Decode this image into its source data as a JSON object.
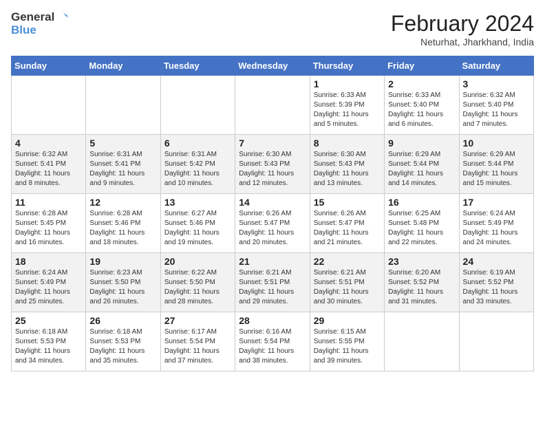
{
  "logo": {
    "text_general": "General",
    "text_blue": "Blue"
  },
  "title": "February 2024",
  "subtitle": "Neturhat, Jharkhand, India",
  "days_of_week": [
    "Sunday",
    "Monday",
    "Tuesday",
    "Wednesday",
    "Thursday",
    "Friday",
    "Saturday"
  ],
  "weeks": [
    [
      {
        "day": "",
        "info": ""
      },
      {
        "day": "",
        "info": ""
      },
      {
        "day": "",
        "info": ""
      },
      {
        "day": "",
        "info": ""
      },
      {
        "day": "1",
        "info": "Sunrise: 6:33 AM\nSunset: 5:39 PM\nDaylight: 11 hours and 5 minutes."
      },
      {
        "day": "2",
        "info": "Sunrise: 6:33 AM\nSunset: 5:40 PM\nDaylight: 11 hours and 6 minutes."
      },
      {
        "day": "3",
        "info": "Sunrise: 6:32 AM\nSunset: 5:40 PM\nDaylight: 11 hours and 7 minutes."
      }
    ],
    [
      {
        "day": "4",
        "info": "Sunrise: 6:32 AM\nSunset: 5:41 PM\nDaylight: 11 hours and 8 minutes."
      },
      {
        "day": "5",
        "info": "Sunrise: 6:31 AM\nSunset: 5:41 PM\nDaylight: 11 hours and 9 minutes."
      },
      {
        "day": "6",
        "info": "Sunrise: 6:31 AM\nSunset: 5:42 PM\nDaylight: 11 hours and 10 minutes."
      },
      {
        "day": "7",
        "info": "Sunrise: 6:30 AM\nSunset: 5:43 PM\nDaylight: 11 hours and 12 minutes."
      },
      {
        "day": "8",
        "info": "Sunrise: 6:30 AM\nSunset: 5:43 PM\nDaylight: 11 hours and 13 minutes."
      },
      {
        "day": "9",
        "info": "Sunrise: 6:29 AM\nSunset: 5:44 PM\nDaylight: 11 hours and 14 minutes."
      },
      {
        "day": "10",
        "info": "Sunrise: 6:29 AM\nSunset: 5:44 PM\nDaylight: 11 hours and 15 minutes."
      }
    ],
    [
      {
        "day": "11",
        "info": "Sunrise: 6:28 AM\nSunset: 5:45 PM\nDaylight: 11 hours and 16 minutes."
      },
      {
        "day": "12",
        "info": "Sunrise: 6:28 AM\nSunset: 5:46 PM\nDaylight: 11 hours and 18 minutes."
      },
      {
        "day": "13",
        "info": "Sunrise: 6:27 AM\nSunset: 5:46 PM\nDaylight: 11 hours and 19 minutes."
      },
      {
        "day": "14",
        "info": "Sunrise: 6:26 AM\nSunset: 5:47 PM\nDaylight: 11 hours and 20 minutes."
      },
      {
        "day": "15",
        "info": "Sunrise: 6:26 AM\nSunset: 5:47 PM\nDaylight: 11 hours and 21 minutes."
      },
      {
        "day": "16",
        "info": "Sunrise: 6:25 AM\nSunset: 5:48 PM\nDaylight: 11 hours and 22 minutes."
      },
      {
        "day": "17",
        "info": "Sunrise: 6:24 AM\nSunset: 5:49 PM\nDaylight: 11 hours and 24 minutes."
      }
    ],
    [
      {
        "day": "18",
        "info": "Sunrise: 6:24 AM\nSunset: 5:49 PM\nDaylight: 11 hours and 25 minutes."
      },
      {
        "day": "19",
        "info": "Sunrise: 6:23 AM\nSunset: 5:50 PM\nDaylight: 11 hours and 26 minutes."
      },
      {
        "day": "20",
        "info": "Sunrise: 6:22 AM\nSunset: 5:50 PM\nDaylight: 11 hours and 28 minutes."
      },
      {
        "day": "21",
        "info": "Sunrise: 6:21 AM\nSunset: 5:51 PM\nDaylight: 11 hours and 29 minutes."
      },
      {
        "day": "22",
        "info": "Sunrise: 6:21 AM\nSunset: 5:51 PM\nDaylight: 11 hours and 30 minutes."
      },
      {
        "day": "23",
        "info": "Sunrise: 6:20 AM\nSunset: 5:52 PM\nDaylight: 11 hours and 31 minutes."
      },
      {
        "day": "24",
        "info": "Sunrise: 6:19 AM\nSunset: 5:52 PM\nDaylight: 11 hours and 33 minutes."
      }
    ],
    [
      {
        "day": "25",
        "info": "Sunrise: 6:18 AM\nSunset: 5:53 PM\nDaylight: 11 hours and 34 minutes."
      },
      {
        "day": "26",
        "info": "Sunrise: 6:18 AM\nSunset: 5:53 PM\nDaylight: 11 hours and 35 minutes."
      },
      {
        "day": "27",
        "info": "Sunrise: 6:17 AM\nSunset: 5:54 PM\nDaylight: 11 hours and 37 minutes."
      },
      {
        "day": "28",
        "info": "Sunrise: 6:16 AM\nSunset: 5:54 PM\nDaylight: 11 hours and 38 minutes."
      },
      {
        "day": "29",
        "info": "Sunrise: 6:15 AM\nSunset: 5:55 PM\nDaylight: 11 hours and 39 minutes."
      },
      {
        "day": "",
        "info": ""
      },
      {
        "day": "",
        "info": ""
      }
    ]
  ]
}
